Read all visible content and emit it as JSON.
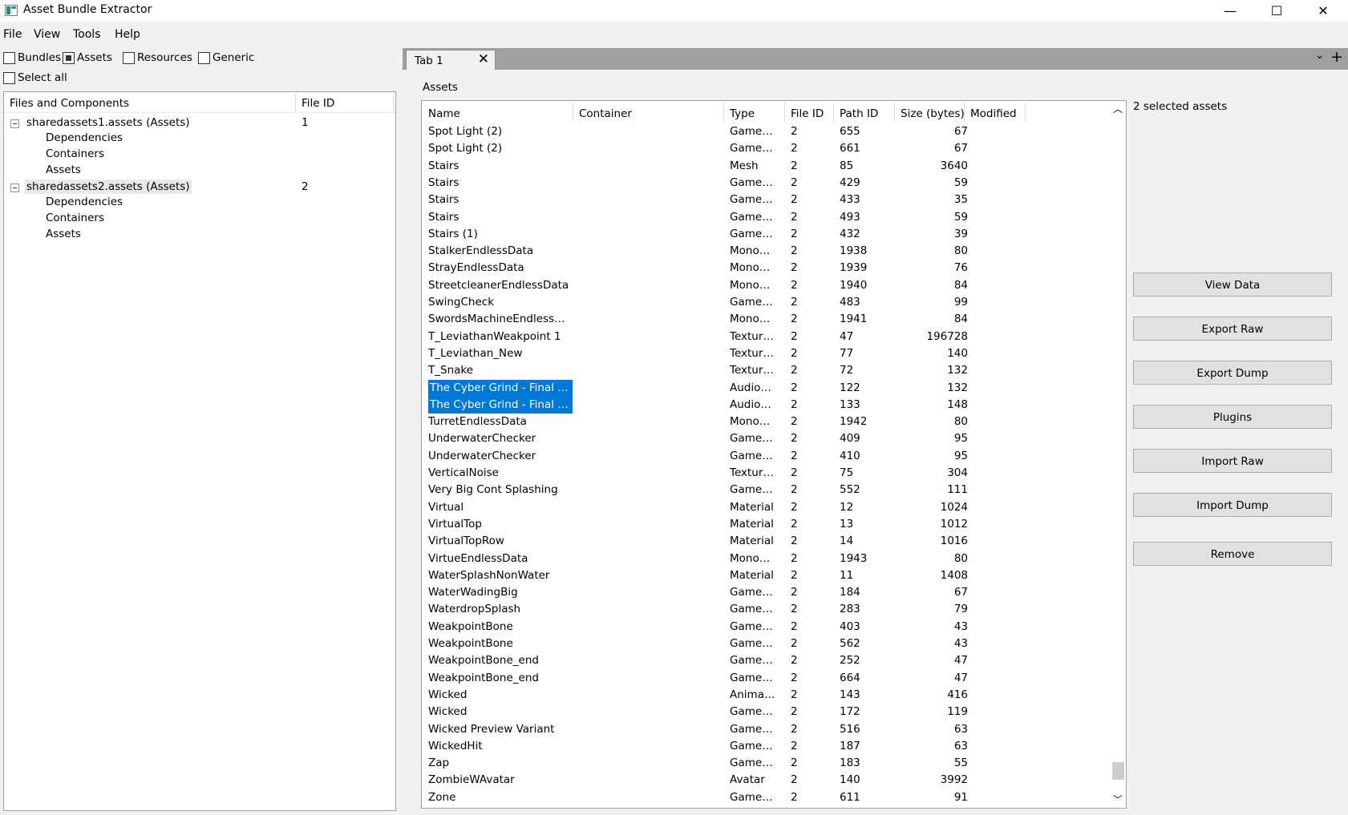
{
  "window": {
    "title": "Asset Bundle Extractor",
    "minimize_glyph": "—",
    "maximize_glyph": "☐",
    "close_glyph": "✕"
  },
  "menu": [
    "File",
    "View",
    "Tools",
    "Help"
  ],
  "filters": {
    "bundles": {
      "label": "Bundles",
      "checked": false
    },
    "assets": {
      "label": "Assets",
      "checked": true
    },
    "resources": {
      "label": "Resources",
      "checked": false
    },
    "generic": {
      "label": "Generic",
      "checked": false
    },
    "select_all": {
      "label": "Select all",
      "checked": false
    }
  },
  "tree": {
    "col_files": "Files and Components",
    "col_fileid": "File ID",
    "nodes": [
      {
        "label": "sharedassets1.assets (Assets)",
        "file_id": "1",
        "children": [
          "Dependencies",
          "Containers",
          "Assets"
        ]
      },
      {
        "label": "sharedassets2.assets (Assets)",
        "file_id": "2",
        "children": [
          "Dependencies",
          "Containers",
          "Assets"
        ]
      }
    ]
  },
  "tabs": {
    "active_label": "Tab 1",
    "close_glyph": "✕",
    "menu_glyph": "⌄",
    "add_glyph": "+"
  },
  "assets_panel": {
    "label": "Assets",
    "columns": [
      "Name",
      "Container",
      "Type",
      "File ID",
      "Path ID",
      "Size (bytes)",
      "Modified"
    ],
    "rows": [
      {
        "name": "Spot Light (2)",
        "type": "GameO…",
        "file_id": "2",
        "path_id": "655",
        "size": "67"
      },
      {
        "name": "Spot Light (2)",
        "type": "GameO…",
        "file_id": "2",
        "path_id": "661",
        "size": "67"
      },
      {
        "name": "Stairs",
        "type": "Mesh",
        "file_id": "2",
        "path_id": "85",
        "size": "3640"
      },
      {
        "name": "Stairs",
        "type": "GameO…",
        "file_id": "2",
        "path_id": "429",
        "size": "59"
      },
      {
        "name": "Stairs",
        "type": "GameO…",
        "file_id": "2",
        "path_id": "433",
        "size": "35"
      },
      {
        "name": "Stairs",
        "type": "GameO…",
        "file_id": "2",
        "path_id": "493",
        "size": "59"
      },
      {
        "name": "Stairs (1)",
        "type": "GameO…",
        "file_id": "2",
        "path_id": "432",
        "size": "39"
      },
      {
        "name": "StalkerEndlessData",
        "type": "MonoB…",
        "file_id": "2",
        "path_id": "1938",
        "size": "80"
      },
      {
        "name": "StrayEndlessData",
        "type": "MonoB…",
        "file_id": "2",
        "path_id": "1939",
        "size": "76"
      },
      {
        "name": "StreetcleanerEndlessData",
        "type": "MonoB…",
        "file_id": "2",
        "path_id": "1940",
        "size": "84"
      },
      {
        "name": "SwingCheck",
        "type": "GameO…",
        "file_id": "2",
        "path_id": "483",
        "size": "99"
      },
      {
        "name": "SwordsMachineEndlessData",
        "type": "MonoB…",
        "file_id": "2",
        "path_id": "1941",
        "size": "84"
      },
      {
        "name": "T_LeviathanWeakpoint 1",
        "type": "Textur…",
        "file_id": "2",
        "path_id": "47",
        "size": "196728"
      },
      {
        "name": "T_Leviathan_New",
        "type": "Textur…",
        "file_id": "2",
        "path_id": "77",
        "size": "140"
      },
      {
        "name": "T_Snake",
        "type": "Textur…",
        "file_id": "2",
        "path_id": "72",
        "size": "132"
      },
      {
        "name": "The Cyber Grind - Final Ver…",
        "type": "AudioClip",
        "file_id": "2",
        "path_id": "122",
        "size": "132",
        "selected": true
      },
      {
        "name": "The Cyber Grind - Final Ver…",
        "type": "AudioClip",
        "file_id": "2",
        "path_id": "133",
        "size": "148",
        "selected": true
      },
      {
        "name": "TurretEndlessData",
        "type": "MonoB…",
        "file_id": "2",
        "path_id": "1942",
        "size": "80"
      },
      {
        "name": "UnderwaterChecker",
        "type": "GameO…",
        "file_id": "2",
        "path_id": "409",
        "size": "95"
      },
      {
        "name": "UnderwaterChecker",
        "type": "GameO…",
        "file_id": "2",
        "path_id": "410",
        "size": "95"
      },
      {
        "name": "VerticalNoise",
        "type": "Textur…",
        "file_id": "2",
        "path_id": "75",
        "size": "304"
      },
      {
        "name": "Very Big Cont Splashing",
        "type": "GameO…",
        "file_id": "2",
        "path_id": "552",
        "size": "111"
      },
      {
        "name": "Virtual",
        "type": "Material",
        "file_id": "2",
        "path_id": "12",
        "size": "1024"
      },
      {
        "name": "VirtualTop",
        "type": "Material",
        "file_id": "2",
        "path_id": "13",
        "size": "1012"
      },
      {
        "name": "VirtualTopRow",
        "type": "Material",
        "file_id": "2",
        "path_id": "14",
        "size": "1016"
      },
      {
        "name": "VirtueEndlessData",
        "type": "MonoB…",
        "file_id": "2",
        "path_id": "1943",
        "size": "80"
      },
      {
        "name": "WaterSplashNonWater",
        "type": "Material",
        "file_id": "2",
        "path_id": "11",
        "size": "1408"
      },
      {
        "name": "WaterWadingBig",
        "type": "GameO…",
        "file_id": "2",
        "path_id": "184",
        "size": "67"
      },
      {
        "name": "WaterdropSplash",
        "type": "GameO…",
        "file_id": "2",
        "path_id": "283",
        "size": "79"
      },
      {
        "name": "WeakpointBone",
        "type": "GameO…",
        "file_id": "2",
        "path_id": "403",
        "size": "43"
      },
      {
        "name": "WeakpointBone",
        "type": "GameO…",
        "file_id": "2",
        "path_id": "562",
        "size": "43"
      },
      {
        "name": "WeakpointBone_end",
        "type": "GameO…",
        "file_id": "2",
        "path_id": "252",
        "size": "47"
      },
      {
        "name": "WeakpointBone_end",
        "type": "GameO…",
        "file_id": "2",
        "path_id": "664",
        "size": "47"
      },
      {
        "name": "Wicked",
        "type": "Animat…",
        "file_id": "2",
        "path_id": "143",
        "size": "416"
      },
      {
        "name": "Wicked",
        "type": "GameO…",
        "file_id": "2",
        "path_id": "172",
        "size": "119"
      },
      {
        "name": "Wicked Preview Variant",
        "type": "GameO…",
        "file_id": "2",
        "path_id": "516",
        "size": "63"
      },
      {
        "name": "WickedHit",
        "type": "GameO…",
        "file_id": "2",
        "path_id": "187",
        "size": "63"
      },
      {
        "name": "Zap",
        "type": "GameO…",
        "file_id": "2",
        "path_id": "183",
        "size": "55"
      },
      {
        "name": "ZombieWAvatar",
        "type": "Avatar",
        "file_id": "2",
        "path_id": "140",
        "size": "3992"
      },
      {
        "name": "Zone",
        "type": "GameO…",
        "file_id": "2",
        "path_id": "611",
        "size": "91"
      }
    ]
  },
  "side": {
    "selected_count": "2 selected assets",
    "buttons": [
      "View Data",
      "Export Raw",
      "Export Dump",
      "Plugins",
      "Import Raw",
      "Import Dump",
      "Remove"
    ]
  },
  "colors": {
    "selection": "#0078d7",
    "tabstrip": "#a0a0a0"
  }
}
